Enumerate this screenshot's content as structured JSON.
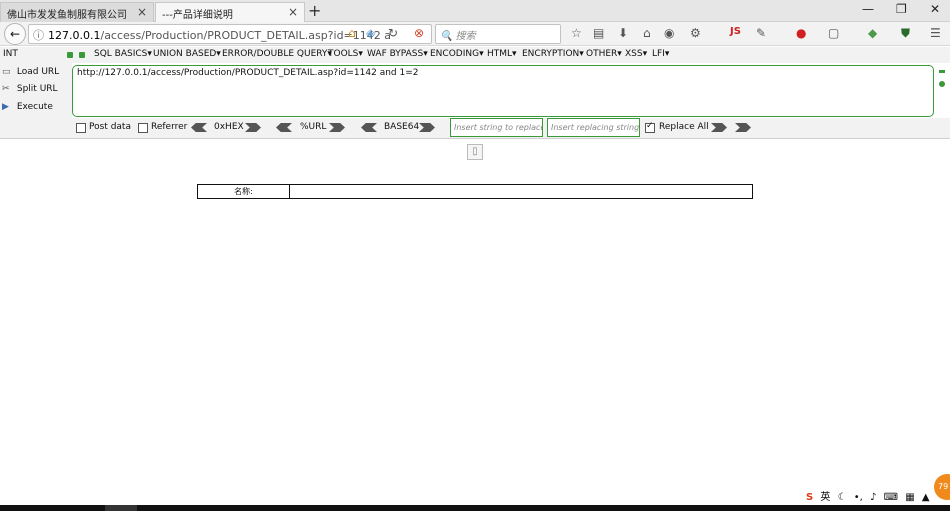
{
  "tabs": [
    {
      "title": "佛山市发发鱼制服有限公司",
      "close": "×"
    },
    {
      "title": "---产品详细说明",
      "close": "×"
    }
  ],
  "new_tab": "+",
  "window_controls": {
    "minimize": "—",
    "restore": "❐",
    "close": "✕"
  },
  "nav": {
    "back": "←",
    "info": "ⓘ",
    "url_host": "127.0.0.1",
    "url_path": "/access/Production/PRODUCT_DETAIL.asp?id=1142 a",
    "reload": "↻",
    "search_placeholder": "搜索",
    "js_label": "JS"
  },
  "hackbar": {
    "select_value": "INT",
    "menus": [
      "SQL BASICS▾",
      "UNION BASED▾",
      "ERROR/DOUBLE QUERY▾",
      "TOOLS▾",
      "WAF BYPASS▾",
      "ENCODING▾",
      "HTML▾",
      "ENCRYPTION▾",
      "OTHER▾",
      "XSS▾",
      "LFI▾"
    ],
    "load_url": "Load URL",
    "split_url": "Split URL",
    "execute": "Execute",
    "url_value": "http://127.0.0.1/access/Production/PRODUCT_DETAIL.asp?id=1142 and 1=2",
    "post_data": "Post data",
    "referrer": "Referrer",
    "hex": "0xHEX",
    "url_enc": "%URL",
    "base64": "BASE64",
    "replace_placeholder": "Insert string to replace",
    "replacing_placeholder": "Insert replacing string",
    "replace_all": "Replace All",
    "post_checked": false,
    "referrer_checked": false,
    "replace_all_checked": true
  },
  "page": {
    "table_label": "名称:",
    "table_value": ""
  },
  "tray": {
    "sogou": "S",
    "ime": "英",
    "badge": "79"
  },
  "colors": {
    "accent_green": "#3a9a3a",
    "tabbar": "#e6e6e6"
  }
}
